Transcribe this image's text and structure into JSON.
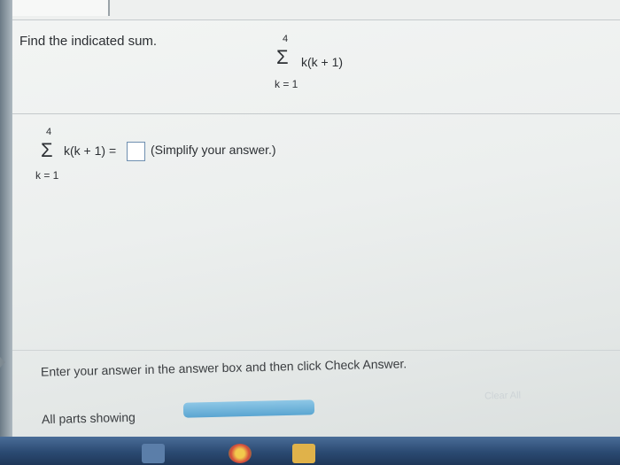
{
  "problem": {
    "instruction": "Find the indicated sum.",
    "sum": {
      "upper_limit": "4",
      "symbol": "Σ",
      "expression": "k(k + 1)",
      "lower_limit": "k = 1"
    }
  },
  "answer": {
    "sum": {
      "upper_limit": "4",
      "symbol": "Σ",
      "expression": "k(k + 1) =",
      "lower_limit": "k = 1"
    },
    "input_value": "",
    "hint": "(Simplify your answer.)"
  },
  "footer": {
    "instruction": "Enter your answer in the answer box and then click Check Answer.",
    "clear_all_label": "Clear All",
    "parts_label": "All parts showing"
  },
  "colors": {
    "taskbar": "#2b4a72",
    "check_button": "#6fb2da",
    "answer_box_border": "#6f8fb0"
  }
}
